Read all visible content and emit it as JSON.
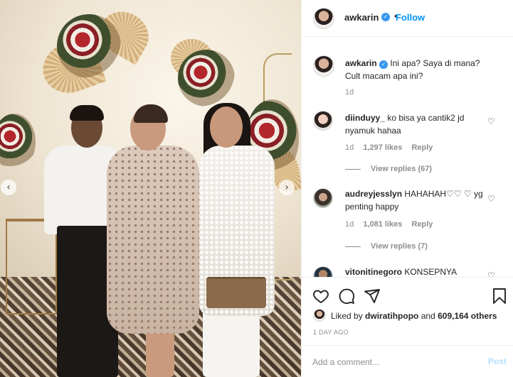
{
  "post": {
    "image_alt": "",
    "carousel_prev": "‹",
    "carousel_next": "›"
  },
  "header": {
    "username": "awkarin",
    "verified_icon": "verified-badge-icon",
    "separator": "•",
    "follow_label": "Follow"
  },
  "caption": {
    "username": "awkarin",
    "text": "Ini apa? Saya di mana? Cult macam apa ini?",
    "time": "1d"
  },
  "comments": [
    {
      "username": "diinduyy_",
      "text": "ko bisa ya cantik2 jd nyamuk hahaa",
      "time": "1d",
      "likes": "1,297 likes",
      "reply_label": "Reply",
      "view_replies": "View replies (67)"
    },
    {
      "username": "audreyjesslyn",
      "text": "HAHAHAH♡♡ ♡ yg penting happy",
      "time": "1d",
      "likes": "1,081 likes",
      "reply_label": "Reply",
      "view_replies": "View replies (7)"
    },
    {
      "username": "vitonitinegoro",
      "text": "KONSEPNYA"
    }
  ],
  "actions": {
    "icons": [
      "heart-icon",
      "comment-icon",
      "share-icon",
      "save-icon"
    ]
  },
  "likes": {
    "prefix": "Liked by",
    "user": "dwiratihpopo",
    "connector": "and",
    "count": "609,164 others"
  },
  "date": "1 DAY AGO",
  "add_comment": {
    "placeholder": "Add a comment...",
    "post_label": "Post"
  },
  "colors": {
    "link_blue": "#0095f6",
    "post_disabled": "#b2dffc",
    "meta_gray": "#8e8e8e",
    "text": "#262626"
  }
}
